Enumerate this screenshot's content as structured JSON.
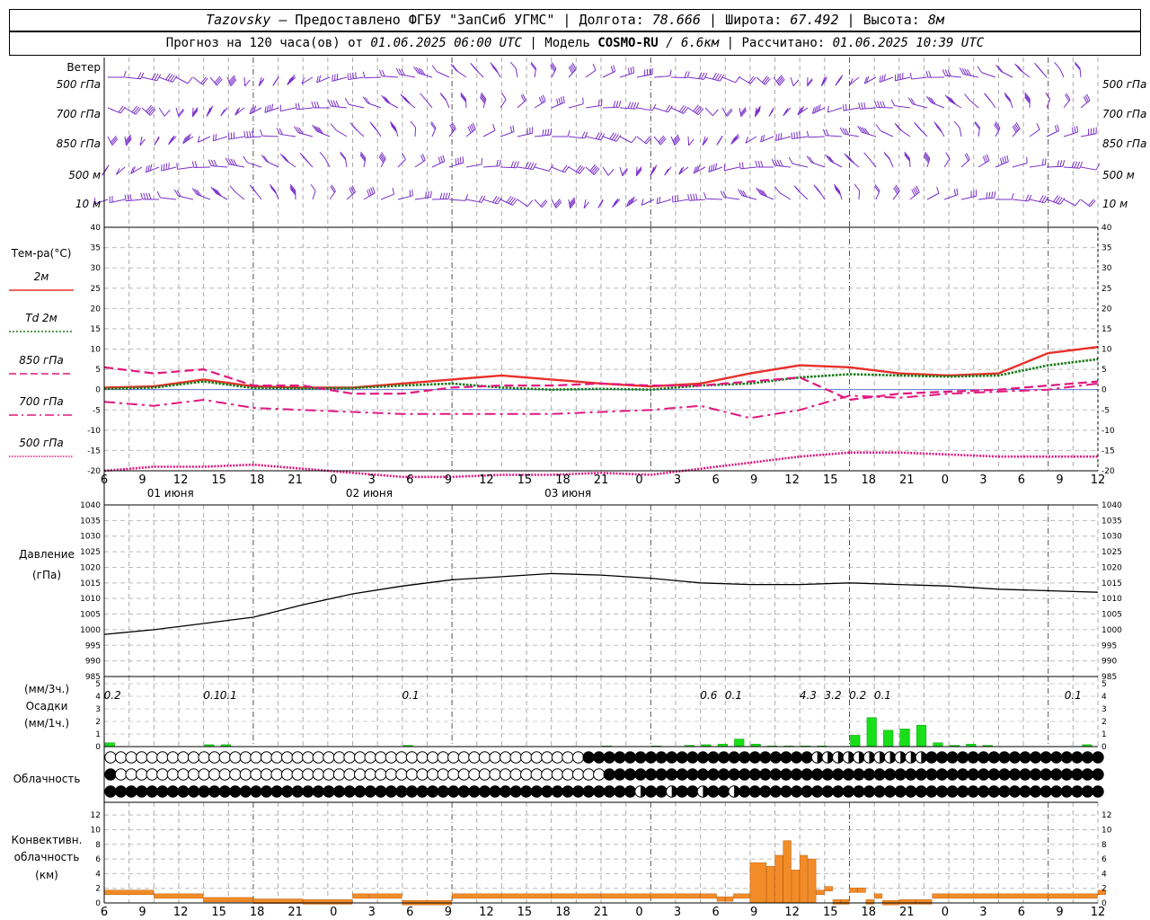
{
  "header": {
    "station": "Tazovsky",
    "provider": " – Предоставлено ФГБУ \"ЗапСиб УГМС\"",
    "lon_label": "Долгота:",
    "lon_value": "78.666",
    "lat_label": "Широта:",
    "lat_value": "67.492",
    "alt_label": "Высота:",
    "alt_value": "8м",
    "forecast_prefix": "Прогноз на 120 часа(ов) от",
    "forecast_start": "01.06.2025 06:00 UTC",
    "model_label": "Модель",
    "model_name": "COSMO-RU",
    "model_res": "/ 6.6км",
    "calc_label": "Рассчитано:",
    "calc_time": "01.06.2025 10:39 UTC"
  },
  "wind_panel": {
    "title": "Ветер",
    "levels": [
      "500 гПа",
      "700 гПа",
      "850 гПа",
      "500 м",
      "10  м"
    ],
    "color": "#7a2fc8"
  },
  "temp_panel": {
    "title": "Тем-ра(°С)",
    "legend": [
      {
        "label": "2м",
        "color": "#e8302a",
        "style": "solid"
      },
      {
        "label": "Td  2м",
        "color": "#1a7a1a",
        "style": "dotted"
      },
      {
        "label": "850 гПа",
        "color": "#e0177f",
        "style": "dashed"
      },
      {
        "label": "700 гПа",
        "color": "#e0177f",
        "style": "dashdot"
      },
      {
        "label": "500 гПа",
        "color": "#e0177f",
        "style": "densedot"
      }
    ]
  },
  "pressure_panel": {
    "title": "Давление",
    "unit": "(гПа)"
  },
  "precip_panel": {
    "unit_3h": "(мм/3ч.)",
    "title": "Осадки",
    "unit_1h": "(мм/1ч.)"
  },
  "cloud_panel": {
    "title": "Облачность"
  },
  "conv_panel": {
    "title1": "Конвективн.",
    "title2": "облачность",
    "unit": "(км)"
  },
  "time_axis": {
    "hour_labels": [
      "6",
      "9",
      "12",
      "15",
      "18",
      "21",
      "0",
      "3",
      "6",
      "9",
      "12",
      "15",
      "18",
      "21",
      "0",
      "3",
      "6",
      "9",
      "12",
      "15",
      "18",
      "21",
      "0",
      "3",
      "6",
      "9",
      "12"
    ],
    "day_labels": [
      "01 июня",
      "02 июня",
      "03 июня"
    ]
  },
  "chart_data": [
    {
      "type": "line",
      "title": "Тем-ра(°С)",
      "ylim": [
        -20,
        40
      ],
      "x_hours_from_start": [
        0,
        6,
        12,
        18,
        24,
        30,
        36,
        42,
        48,
        54,
        60,
        66,
        72,
        78,
        84,
        90,
        96,
        102,
        108,
        114,
        120
      ],
      "series": [
        {
          "name": "2м",
          "color": "#e8302a",
          "values": [
            0.5,
            0.8,
            2.5,
            0.8,
            0.5,
            0.5,
            1.5,
            2.5,
            3.5,
            2.5,
            1.5,
            0.8,
            1.5,
            4.0,
            6.0,
            5.5,
            4.0,
            3.5,
            4.0,
            9.0,
            10.5
          ]
        },
        {
          "name": "Td  2м",
          "color": "#1a7a1a",
          "values": [
            0.2,
            0.5,
            2.0,
            0.4,
            0.3,
            0.4,
            1.0,
            1.5,
            0.5,
            0.0,
            0.2,
            0.0,
            1.0,
            1.5,
            3.0,
            3.8,
            3.5,
            3.2,
            3.5,
            6.0,
            7.5
          ]
        },
        {
          "name": "850 гПа",
          "color": "#e0177f",
          "values": [
            5.5,
            4.0,
            5.0,
            1.0,
            1.0,
            -1.0,
            -1.0,
            0.5,
            1.0,
            1.0,
            1.5,
            1.0,
            1.0,
            2.0,
            3.0,
            -2.5,
            -1.0,
            -0.5,
            0.0,
            1.0,
            2.0
          ]
        },
        {
          "name": "700 гПа",
          "color": "#e0177f",
          "values": [
            -3.0,
            -4.0,
            -2.5,
            -4.5,
            -5.0,
            -5.5,
            -6.0,
            -6.0,
            -6.0,
            -6.0,
            -5.5,
            -5.0,
            -4.0,
            -7.0,
            -5.0,
            -1.5,
            -2.0,
            -1.0,
            -0.5,
            0.0,
            1.5
          ]
        },
        {
          "name": "500 гПа",
          "color": "#e0177f",
          "values": [
            -20.0,
            -19.0,
            -19.0,
            -18.5,
            -19.5,
            -20.5,
            -21.5,
            -21.5,
            -21.0,
            -21.0,
            -20.5,
            -21.0,
            -19.5,
            -18.0,
            -16.5,
            -15.5,
            -15.5,
            -16.0,
            -16.5,
            -16.5,
            -16.5
          ]
        }
      ]
    },
    {
      "type": "line",
      "title": "Давление",
      "ylabel": "(гПа)",
      "ylim": [
        985,
        1040
      ],
      "x_hours_from_start": [
        0,
        6,
        12,
        18,
        24,
        30,
        36,
        42,
        48,
        54,
        60,
        66,
        72,
        78,
        84,
        90,
        96,
        102,
        108,
        114,
        120
      ],
      "series": [
        {
          "color": "#000000",
          "values": [
            998.5,
            1000.0,
            1002.0,
            1004.0,
            1008.0,
            1011.5,
            1014.0,
            1016.0,
            1017.0,
            1018.0,
            1017.5,
            1016.5,
            1015.0,
            1014.5,
            1014.5,
            1015.0,
            1014.5,
            1014.0,
            1013.0,
            1012.5,
            1012.0
          ]
        }
      ]
    },
    {
      "type": "bar",
      "title": "Осадки",
      "ylabel": "(мм/1ч.)",
      "ylim": [
        0,
        5
      ],
      "bars_hours_from_start": [
        0,
        12,
        14,
        36,
        60,
        66,
        70,
        72,
        74,
        76,
        78,
        80,
        82,
        84,
        86,
        90,
        92,
        94,
        96,
        98,
        100,
        102,
        104,
        106,
        118
      ],
      "values": [
        0.3,
        0.15,
        0.15,
        0.1,
        0.05,
        0.05,
        0.1,
        0.15,
        0.2,
        0.6,
        0.2,
        0.05,
        0.05,
        0.05,
        0.05,
        0.9,
        2.3,
        1.3,
        1.4,
        1.7,
        0.3,
        0.1,
        0.2,
        0.1,
        0.15
      ],
      "annotations_3h": [
        {
          "hour": 1,
          "text": "0.2"
        },
        {
          "hour": 13,
          "text": "0.1"
        },
        {
          "hour": 15,
          "text": "0.1"
        },
        {
          "hour": 37,
          "text": "0.1"
        },
        {
          "hour": 73,
          "text": "0.6"
        },
        {
          "hour": 76,
          "text": "0.1"
        },
        {
          "hour": 85,
          "text": "4.3"
        },
        {
          "hour": 88,
          "text": "3.2"
        },
        {
          "hour": 91,
          "text": "0.2"
        },
        {
          "hour": 94,
          "text": "0.1"
        },
        {
          "hour": 117,
          "text": "0.1"
        }
      ]
    },
    {
      "type": "bar",
      "title": "Конвективн. облачность",
      "ylabel": "(км)",
      "ylim": [
        0,
        13
      ],
      "bars_hours_from_start": [
        0,
        6,
        12,
        18,
        24,
        30,
        32,
        36,
        42,
        48,
        54,
        60,
        66,
        72,
        74,
        75,
        76,
        78,
        80,
        81,
        82,
        83,
        84,
        85,
        86,
        87,
        88,
        89,
        90,
        91,
        92,
        93,
        94,
        96,
        98,
        100,
        102,
        108,
        114,
        120
      ],
      "values": [
        1.5,
        1.0,
        0.5,
        0.3,
        0.2,
        1.0,
        1.0,
        0.1,
        1.0,
        1.0,
        1.0,
        1.0,
        1.0,
        1.0,
        0.6,
        0.6,
        1.0,
        5.5,
        5.0,
        6.5,
        8.5,
        4.5,
        6.5,
        6.0,
        1.5,
        2.0,
        0.2,
        0.2,
        1.8,
        1.8,
        0.2,
        1.0,
        0.1,
        0.2,
        0.2,
        1.0,
        1.0,
        1.0,
        1.0,
        1.5
      ]
    }
  ]
}
